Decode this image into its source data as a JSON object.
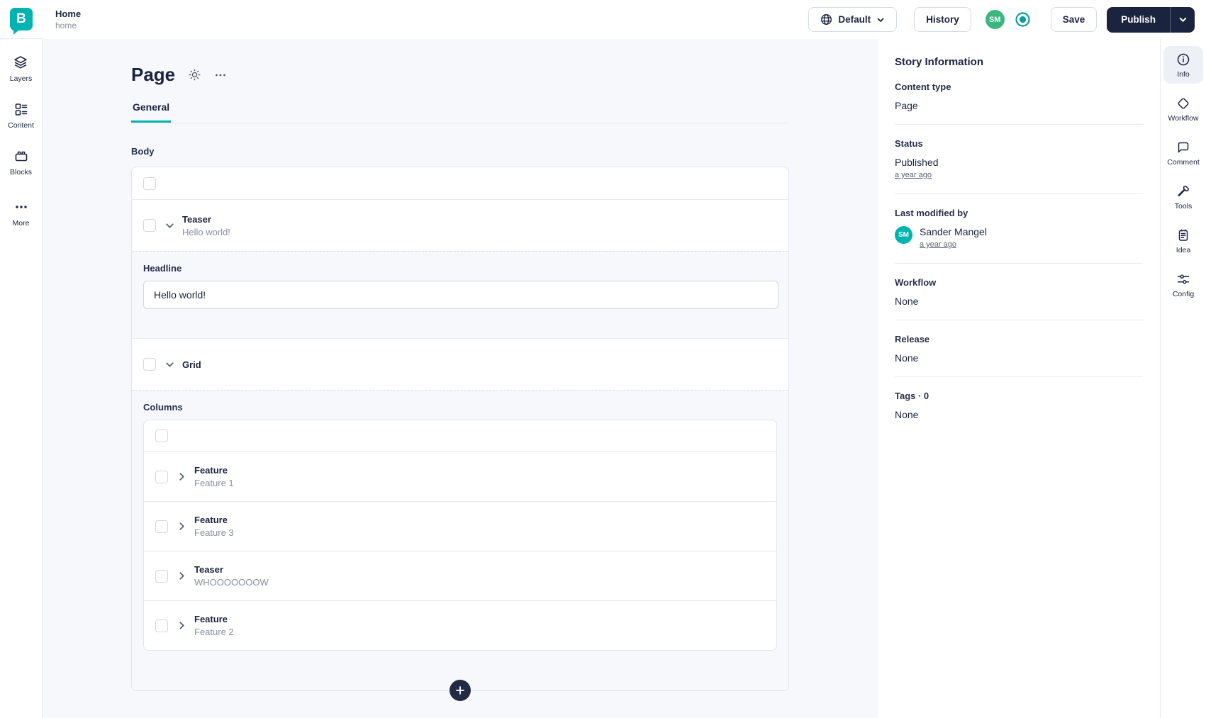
{
  "topbar": {
    "title": "Home",
    "slug": "home",
    "language_label": "Default",
    "history_label": "History",
    "avatar_initials": "SM",
    "save_label": "Save",
    "publish_label": "Publish"
  },
  "left_rail": {
    "items": [
      {
        "icon": "layers-icon",
        "label": "Layers"
      },
      {
        "icon": "content-icon",
        "label": "Content"
      },
      {
        "icon": "blocks-icon",
        "label": "Blocks"
      },
      {
        "icon": "more-icon",
        "label": "More"
      }
    ]
  },
  "editor": {
    "title": "Page",
    "tabs": [
      {
        "label": "General",
        "active": true
      }
    ],
    "body_field": {
      "label": "Body",
      "teaser_block": {
        "type": "Teaser",
        "subtitle": "Hello world!",
        "fields": {
          "headline_label": "Headline",
          "headline_value": "Hello world!"
        }
      },
      "grid_block": {
        "type": "Grid",
        "columns_label": "Columns",
        "children": [
          {
            "type": "Feature",
            "subtitle": "Feature 1"
          },
          {
            "type": "Feature",
            "subtitle": "Feature 3"
          },
          {
            "type": "Teaser",
            "subtitle": "WHOOOOOOOW"
          },
          {
            "type": "Feature",
            "subtitle": "Feature 2"
          }
        ]
      }
    }
  },
  "story_info": {
    "title": "Story Information",
    "content_type": {
      "label": "Content type",
      "value": "Page"
    },
    "status": {
      "label": "Status",
      "value": "Published",
      "link": "a year ago"
    },
    "last_modified": {
      "label": "Last modified by",
      "avatar_initials": "SM",
      "name": "Sander Mangel",
      "link": "a year ago"
    },
    "workflow": {
      "label": "Workflow",
      "value": "None"
    },
    "release": {
      "label": "Release",
      "value": "None"
    },
    "tags": {
      "label": "Tags · 0",
      "value": "None"
    }
  },
  "right_rail": {
    "items": [
      {
        "icon": "info-icon",
        "label": "Info",
        "active": true
      },
      {
        "icon": "workflow-icon",
        "label": "Workflow",
        "active": false
      },
      {
        "icon": "comment-icon",
        "label": "Comment",
        "active": false
      },
      {
        "icon": "tools-icon",
        "label": "Tools",
        "active": false
      },
      {
        "icon": "idea-icon",
        "label": "Idea",
        "active": false
      },
      {
        "icon": "config-icon",
        "label": "Config",
        "active": false
      }
    ]
  },
  "colors": {
    "brand_teal": "#00b3b0",
    "navy": "#1b243f",
    "avatar_green": "#3bb77e",
    "page_background": "#f7f8fc"
  }
}
